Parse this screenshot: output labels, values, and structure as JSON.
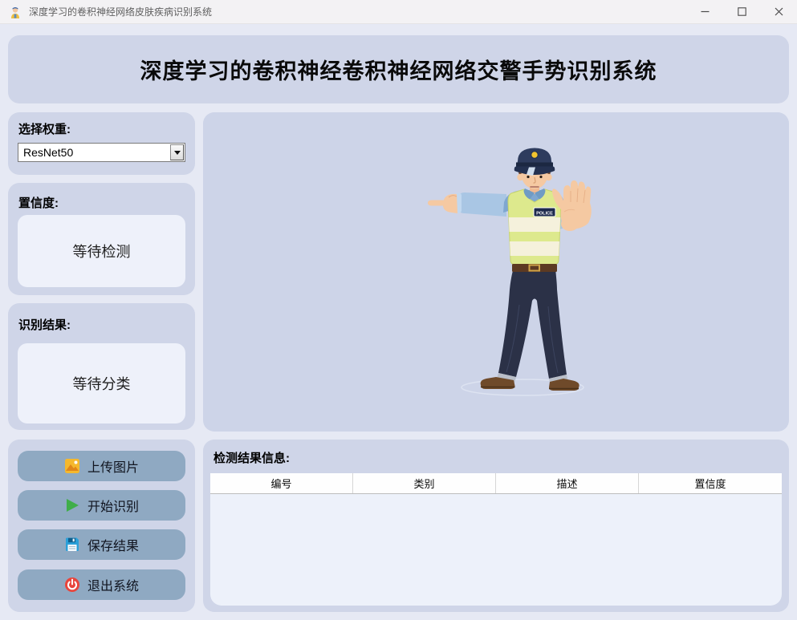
{
  "window": {
    "title": "深度学习的卷积神经网络皮肤疾病识别系统"
  },
  "header": {
    "title": "深度学习的卷积神经卷积神经网络交警手势识别系统"
  },
  "sidebar": {
    "weights": {
      "label": "选择权重:",
      "selected": "ResNet50"
    },
    "confidence": {
      "label": "置信度:",
      "value": "等待检测"
    },
    "result": {
      "label": "识别结果:",
      "value": "等待分类"
    },
    "buttons": [
      {
        "label": "上传图片",
        "icon": "image-upload-icon"
      },
      {
        "label": "开始识别",
        "icon": "play-icon"
      },
      {
        "label": "保存结果",
        "icon": "save-icon"
      },
      {
        "label": "退出系统",
        "icon": "power-icon"
      }
    ]
  },
  "display": {
    "illustration": "traffic-police-officer-stop-gesture",
    "badge_text": "POLICE"
  },
  "results": {
    "label": "检测结果信息:",
    "columns": [
      "编号",
      "类别",
      "描述",
      "置信度"
    ],
    "rows": []
  },
  "colors": {
    "page_background": "#e6e9f4",
    "panel": "#cfd5e8",
    "display_panel": "#cdd4e8",
    "inner_box": "#eef1fa",
    "button": "#8fa9c2",
    "table_header": "#fefefe",
    "table_body": "#edf1fa"
  }
}
